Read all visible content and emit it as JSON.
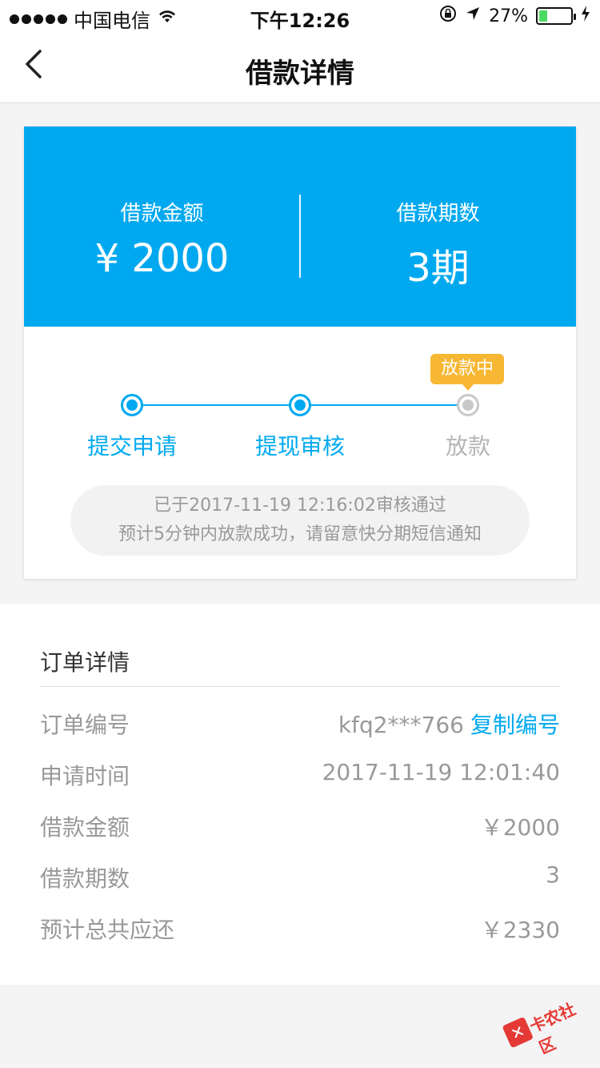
{
  "status_bar": {
    "carrier": "中国电信",
    "time": "下午12:26",
    "battery_percent_text": "27%",
    "battery_level": 0.27
  },
  "nav": {
    "title": "借款详情"
  },
  "summary": {
    "amount_label": "借款金额",
    "amount_value": "¥ 2000",
    "periods_label": "借款期数",
    "periods_value": "3期",
    "accent_color": "#00a9ef"
  },
  "progress": {
    "badge": "放款中",
    "steps": [
      {
        "label": "提交申请",
        "state": "done"
      },
      {
        "label": "提现审核",
        "state": "done"
      },
      {
        "label": "放款",
        "state": "pending"
      }
    ],
    "notice_line1": "已于2017-11-19 12:16:02审核通过",
    "notice_line2": "预计5分钟内放款成功，请留意快分期短信通知"
  },
  "order": {
    "title": "订单详情",
    "rows": [
      {
        "key": "订单编号",
        "value": "kfq2***766",
        "action": "复制编号"
      },
      {
        "key": "申请时间",
        "value": "2017-11-19 12:01:40"
      },
      {
        "key": "借款金额",
        "value": "￥2000"
      },
      {
        "key": "借款期数",
        "value": "3"
      },
      {
        "key": "预计总共应还",
        "value": "￥2330"
      }
    ]
  },
  "watermark": {
    "text": "卡农社区"
  }
}
